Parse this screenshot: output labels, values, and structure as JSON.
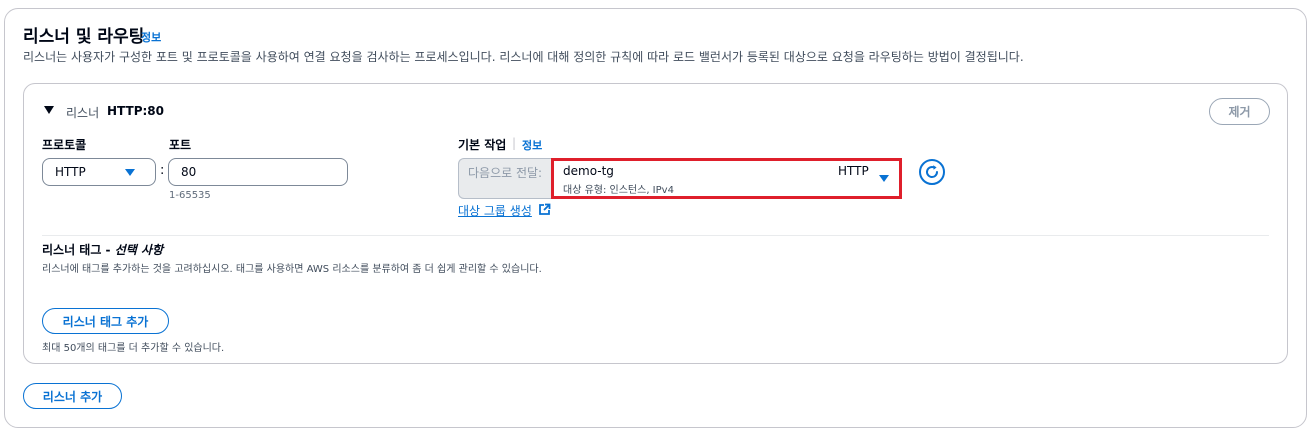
{
  "section": {
    "title": "리스너 및 라우팅",
    "info": "정보",
    "description": "리스너는 사용자가 구성한 포트 및 프로토콜을 사용하여 연결 요청을 검사하는 프로세스입니다. 리스너에 대해 정의한 규칙에 따라 로드 밸런서가 등록된 대상으로 요청을 라우팅하는 방법이 결정됩니다."
  },
  "listener": {
    "prefix": "리스너",
    "name": "HTTP:80",
    "remove_label": "제거",
    "protocol_label": "프로토콜",
    "protocol_value": "HTTP",
    "colon": ":",
    "port_label": "포트",
    "port_value": "80",
    "port_hint": "1-65535",
    "default_action_label": "기본 작업",
    "default_action_sep": "|",
    "default_action_info": "정보",
    "forward_to": "다음으로 전달:",
    "target_group": {
      "name": "demo-tg",
      "meta": "대상 유형: 인스턴스, IPv4",
      "protocol": "HTTP"
    },
    "create_target_group_link": "대상 그룹 생성",
    "tags_heading": "리스너 태그 - ",
    "tags_optional": "선택 사항",
    "tags_description": "리스너에 태그를 추가하는 것을 고려하십시오. 태그를 사용하면 AWS 리소스를 분류하여 좀 더 쉽게 관리할 수 있습니다.",
    "add_tag_label": "리스너 태그 추가",
    "tag_limit": "최대 50개의 태그를 더 추가할 수 있습니다."
  },
  "add_listener_label": "리스너 추가",
  "icons": {
    "expand": "caret-down-icon",
    "dropdown": "chevron-down-icon",
    "refresh": "refresh-icon",
    "external": "external-link-icon"
  },
  "colors": {
    "accent": "#0972d3",
    "highlight": "#df1f2b",
    "text": "#000716",
    "muted": "#414d5c"
  }
}
